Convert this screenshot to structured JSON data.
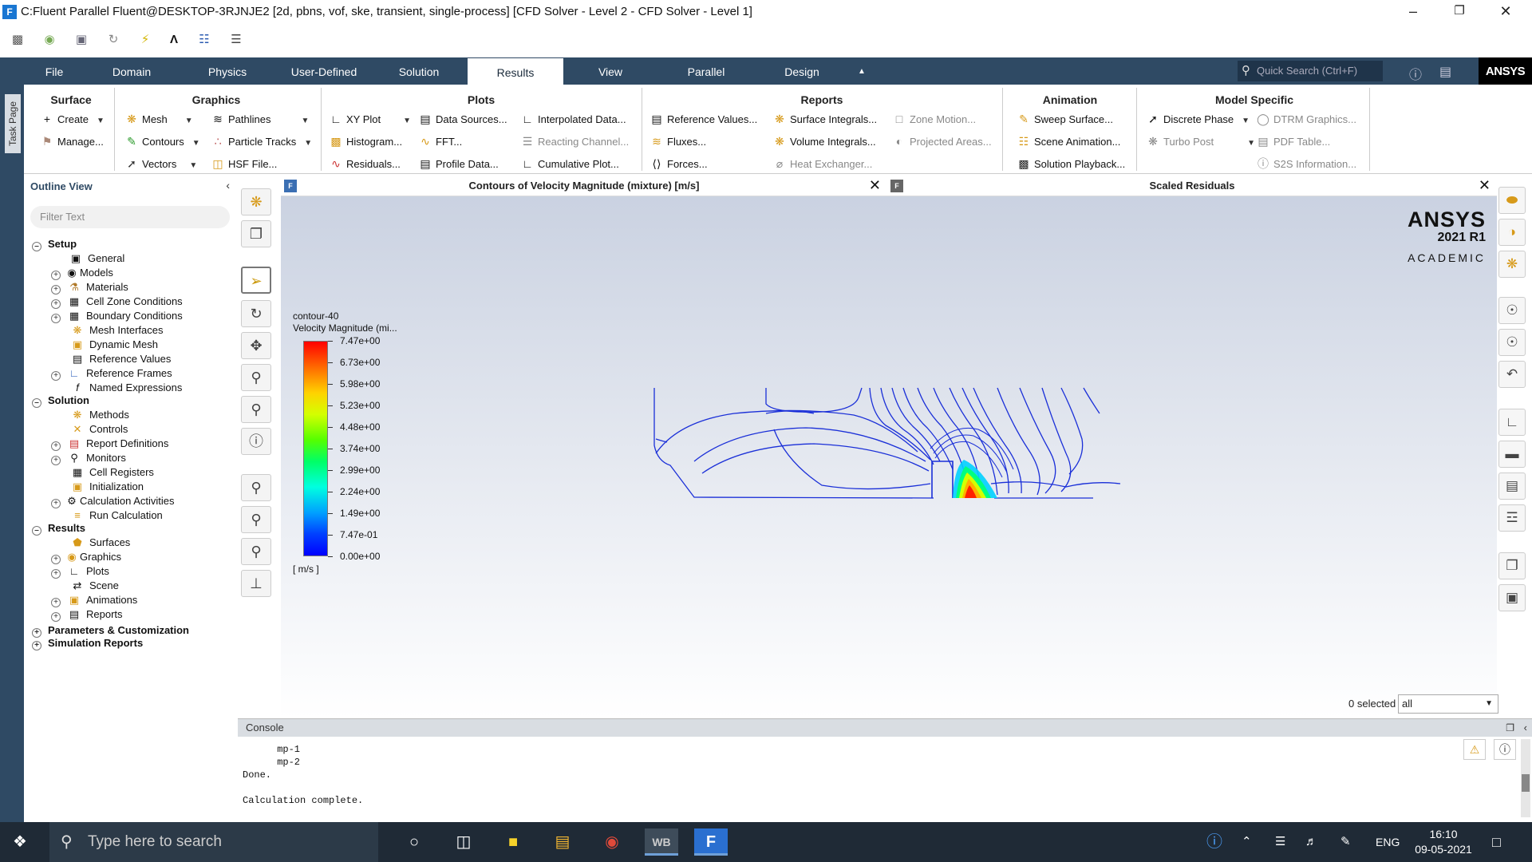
{
  "window": {
    "title": "C:Fluent Parallel Fluent@DESKTOP-3RJNJE2  [2d, pbns, vof, ske, transient, single-process] [CFD Solver - Level 2 - CFD Solver - Level 1]"
  },
  "tabs": [
    "File",
    "Domain",
    "Physics",
    "User-Defined",
    "Solution",
    "Results",
    "View",
    "Parallel",
    "Design"
  ],
  "quick_search": {
    "placeholder": "Quick Search (Ctrl+F)"
  },
  "brand": {
    "top_logo": "ANSYS",
    "name": "ANSYS",
    "version": "2021 R1",
    "edition": "ACADEMIC"
  },
  "task_page": "Task Page",
  "ribbon": {
    "surface": {
      "title": "Surface",
      "create": "Create",
      "manage": "Manage..."
    },
    "graphics": {
      "title": "Graphics",
      "mesh": "Mesh",
      "contours": "Contours",
      "vectors": "Vectors",
      "pathlines": "Pathlines",
      "particle_tracks": "Particle Tracks",
      "hsf_file": "HSF File..."
    },
    "plots": {
      "title": "Plots",
      "xy_plot": "XY Plot",
      "histogram": "Histogram...",
      "residuals": "Residuals...",
      "data_sources": "Data Sources...",
      "fft": "FFT...",
      "profile_data": "Profile Data...",
      "interpolated": "Interpolated Data...",
      "reacting_channel": "Reacting Channel...",
      "cumulative": "Cumulative Plot..."
    },
    "reports": {
      "title": "Reports",
      "reference_values": "Reference Values...",
      "fluxes": "Fluxes...",
      "forces": "Forces...",
      "surface_integrals": "Surface Integrals...",
      "volume_integrals": "Volume Integrals...",
      "heat_exchanger": "Heat Exchanger...",
      "zone_motion": "Zone Motion...",
      "projected_areas": "Projected Areas..."
    },
    "animation": {
      "title": "Animation",
      "sweep_surface": "Sweep Surface...",
      "scene_animation": "Scene Animation...",
      "solution_playback": "Solution Playback..."
    },
    "model_specific": {
      "title": "Model Specific",
      "discrete_phase": "Discrete Phase",
      "turbo_post": "Turbo Post",
      "dtrm_graphics": "DTRM Graphics...",
      "pdf_table": "PDF Table...",
      "s2s_information": "S2S Information..."
    }
  },
  "outline": {
    "title": "Outline View",
    "filter_placeholder": "Filter Text",
    "setup": "Setup",
    "setup_items": [
      "General",
      "Models",
      "Materials",
      "Cell Zone Conditions",
      "Boundary Conditions",
      "Mesh Interfaces",
      "Dynamic Mesh",
      "Reference Values",
      "Reference Frames",
      "Named Expressions"
    ],
    "solution": "Solution",
    "solution_items": [
      "Methods",
      "Controls",
      "Report Definitions",
      "Monitors",
      "Cell Registers",
      "Initialization",
      "Calculation Activities",
      "Run Calculation"
    ],
    "results": "Results",
    "results_items": [
      "Surfaces",
      "Graphics",
      "Plots",
      "Scene",
      "Animations",
      "Reports"
    ],
    "parameters": "Parameters & Customization",
    "simulation_reports": "Simulation Reports"
  },
  "panes": {
    "left_title": "Contours of Velocity Magnitude (mixture)  [m/s]",
    "right_title": "Scaled Residuals",
    "pane_icon": "F"
  },
  "legend": {
    "name": "contour-40",
    "quantity": "Velocity Magnitude (mi...",
    "unit": "[ m/s ]",
    "ticks": [
      "7.47e+00",
      "6.73e+00",
      "5.98e+00",
      "5.23e+00",
      "4.48e+00",
      "3.74e+00",
      "2.99e+00",
      "2.24e+00",
      "1.49e+00",
      "7.47e-01",
      "0.00e+00"
    ]
  },
  "selection": {
    "count": "0 selected",
    "value": "all"
  },
  "console": {
    "title": "Console",
    "lines": "      mp-1\n      mp-2\nDone.\n\nCalculation complete."
  },
  "taskbar": {
    "search_placeholder": "Type here to search",
    "language": "ENG",
    "time": "16:10",
    "date": "09-05-2021",
    "wb_label": "WB",
    "fluent_label": "F"
  },
  "colors": {
    "tabbar": "#2f4a64",
    "contour_lines": "#1a2fd8",
    "accent": "#1976d2"
  }
}
